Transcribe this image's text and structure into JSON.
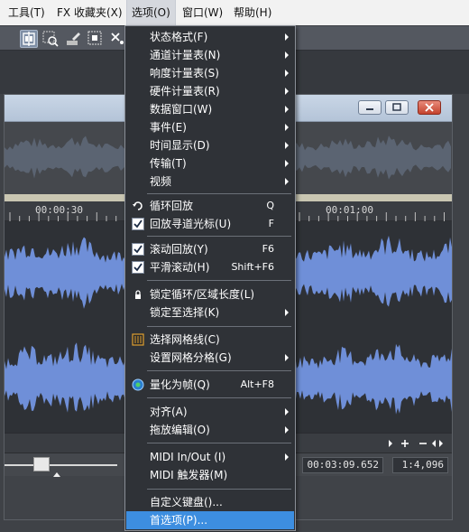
{
  "menubar": {
    "items": [
      {
        "label": "工具(T)"
      },
      {
        "label": "FX 收藏夹(X)"
      },
      {
        "label": "选项(O)"
      },
      {
        "label": "窗口(W)"
      },
      {
        "label": "帮助(H)"
      }
    ]
  },
  "timeline": {
    "marks": [
      "00:00:30",
      "00:01:00"
    ]
  },
  "status": {
    "time": "00:03:09.652",
    "zoom": "1:4,096"
  },
  "colors": {
    "waveform": "#6f8fd8",
    "menu_background": "#2f3237",
    "highlight": "#3d8ee0"
  },
  "options_menu": {
    "items": [
      {
        "label": "状态格式(F)",
        "submenu": true
      },
      {
        "label": "通道计量表(N)",
        "submenu": true
      },
      {
        "label": "响度计量表(S)",
        "submenu": true
      },
      {
        "label": "硬件计量表(R)",
        "submenu": true
      },
      {
        "label": "数据窗口(W)",
        "submenu": true
      },
      {
        "label": "事件(E)",
        "submenu": true
      },
      {
        "label": "时间显示(D)",
        "submenu": true
      },
      {
        "label": "传输(T)",
        "submenu": true
      },
      {
        "label": "视频",
        "submenu": true
      },
      {
        "label": "循环回放",
        "shortcut": "Q",
        "icon": "loop-icon"
      },
      {
        "label": "回放寻道光标(U)",
        "shortcut": "F",
        "checked": true
      },
      {
        "label": "滚动回放(Y)",
        "shortcut": "F6",
        "checked": true
      },
      {
        "label": "平滑滚动(H)",
        "shortcut": "Shift+F6",
        "checked": true
      },
      {
        "label": "锁定循环/区域长度(L)",
        "icon": "lock-icon"
      },
      {
        "label": "锁定至选择(K)",
        "submenu": true
      },
      {
        "label": "选择网格线(C)",
        "icon": "grid-icon"
      },
      {
        "label": "设置网格分格(G)",
        "submenu": true
      },
      {
        "label": "量化为帧(Q)",
        "shortcut": "Alt+F8",
        "icon": "quantize-icon"
      },
      {
        "label": "对齐(A)",
        "submenu": true
      },
      {
        "label": "拖放编辑(O)",
        "submenu": true
      },
      {
        "label": "MIDI In/Out (I)",
        "submenu": true
      },
      {
        "label": "MIDI 触发器(M)"
      },
      {
        "label": "自定义键盘()..."
      },
      {
        "label": "首选项(P)...",
        "highlighted": true
      }
    ]
  }
}
